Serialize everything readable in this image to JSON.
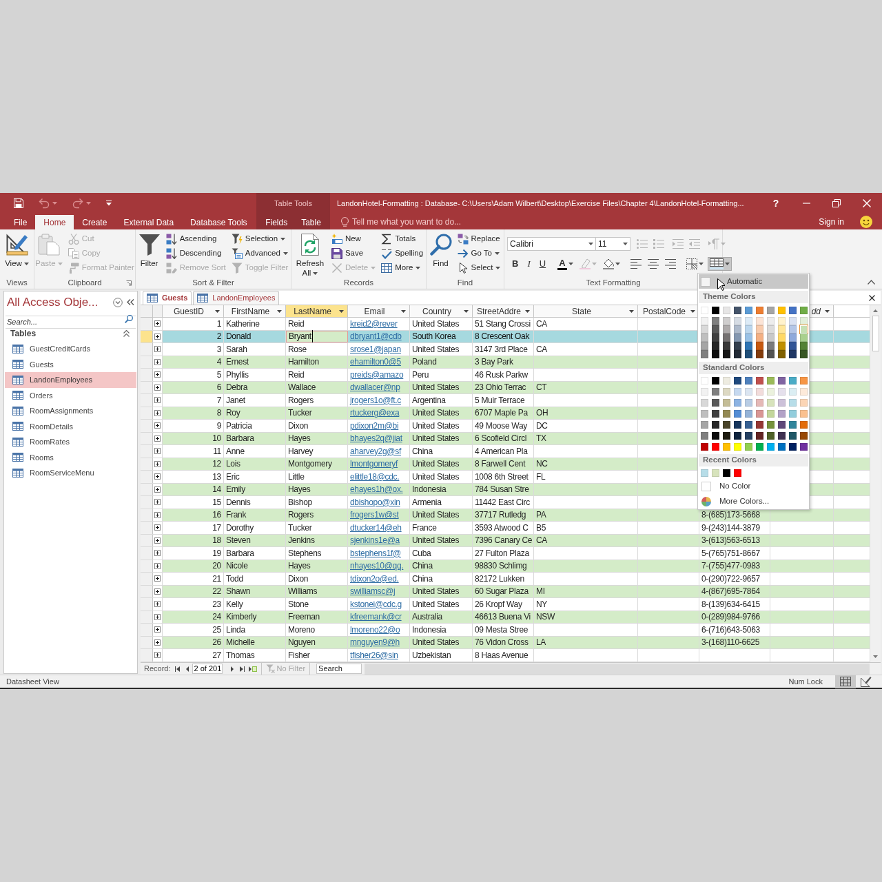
{
  "window": {
    "title": "LandonHotel-Formatting : Database- C:\\Users\\Adam Wilbert\\Desktop\\Exercise Files\\Chapter 4\\LandonHotel-Formatting...",
    "help": "?",
    "context_label": "Table Tools"
  },
  "quick_access": [
    {
      "kind": "save",
      "disabled": false
    },
    {
      "kind": "undo",
      "disabled": true,
      "dropdown": true
    },
    {
      "kind": "redo",
      "disabled": true,
      "dropdown": true
    },
    {
      "kind": "customize",
      "disabled": false
    }
  ],
  "ribbon_tabs": [
    {
      "label": "File",
      "selected": false,
      "contextual": false
    },
    {
      "label": "Home",
      "selected": true,
      "contextual": false
    },
    {
      "label": "Create",
      "selected": false,
      "contextual": false
    },
    {
      "label": "External Data",
      "selected": false,
      "contextual": false
    },
    {
      "label": "Database Tools",
      "selected": false,
      "contextual": false
    },
    {
      "label": "Fields",
      "selected": false,
      "contextual": true
    },
    {
      "label": "Table",
      "selected": false,
      "contextual": true
    }
  ],
  "tell_me": {
    "placeholder": "Tell me what you want to do..."
  },
  "account": {
    "label": "Sign in"
  },
  "ribbon_groups": [
    {
      "label": "Views",
      "kind": "commands",
      "launcher": false,
      "columns": [
        [
          {
            "large": true,
            "kind": "view",
            "label": "View",
            "dropdown": true,
            "disabled": false
          }
        ]
      ]
    },
    {
      "label": "Clipboard",
      "kind": "commands",
      "launcher": true,
      "columns": [
        [
          {
            "large": true,
            "kind": "paste",
            "label": "Paste",
            "dropdown": true,
            "disabled": true
          }
        ],
        [
          {
            "kind": "cut",
            "label": "Cut",
            "disabled": true
          },
          {
            "kind": "copy",
            "label": "Copy",
            "disabled": true
          },
          {
            "kind": "format-painter",
            "label": "Format Painter",
            "disabled": true
          }
        ]
      ]
    },
    {
      "label": "Sort & Filter",
      "kind": "commands",
      "launcher": false,
      "columns": [
        [
          {
            "large": true,
            "kind": "filter",
            "label": "Filter",
            "disabled": false
          }
        ],
        [
          {
            "kind": "ascending",
            "label": "Ascending",
            "disabled": false
          },
          {
            "kind": "descending",
            "label": "Descending",
            "disabled": false
          },
          {
            "kind": "remove-sort",
            "label": "Remove Sort",
            "disabled": true
          }
        ],
        [
          {
            "kind": "selection",
            "label": "Selection",
            "dropdown": true,
            "disabled": false
          },
          {
            "kind": "advanced",
            "label": "Advanced",
            "dropdown": true,
            "disabled": false
          },
          {
            "kind": "toggle-filter",
            "label": "Toggle Filter",
            "disabled": true
          }
        ]
      ]
    },
    {
      "label": "Records",
      "kind": "commands",
      "launcher": false,
      "columns": [
        [
          {
            "large": true,
            "kind": "refresh",
            "label": "Refresh All",
            "dropdown": true,
            "disabled": false
          }
        ],
        [
          {
            "kind": "new",
            "label": "New",
            "disabled": false
          },
          {
            "kind": "save",
            "label": "Save",
            "disabled": false
          },
          {
            "kind": "delete",
            "label": "Delete",
            "dropdown": true,
            "disabled": true
          }
        ],
        [
          {
            "kind": "totals",
            "label": "Totals",
            "disabled": false
          },
          {
            "kind": "spelling",
            "label": "Spelling",
            "disabled": false
          },
          {
            "kind": "more",
            "label": "More",
            "dropdown": true,
            "disabled": false
          }
        ]
      ]
    },
    {
      "label": "Find",
      "kind": "commands",
      "launcher": false,
      "columns": [
        [
          {
            "large": true,
            "kind": "find",
            "label": "Find",
            "disabled": false
          }
        ],
        [
          {
            "kind": "replace",
            "label": "Replace",
            "disabled": false
          },
          {
            "kind": "goto",
            "label": "Go To",
            "dropdown": true,
            "disabled": false
          },
          {
            "kind": "select",
            "label": "Select",
            "dropdown": true,
            "disabled": false
          }
        ]
      ]
    },
    {
      "label": "Text Formatting",
      "kind": "formatting",
      "launcher": false,
      "font": {
        "value": "Calibri"
      },
      "size": {
        "value": "11"
      },
      "top": [
        [
          {
            "kind": "bullets",
            "disabled": true
          },
          {
            "kind": "numbering",
            "disabled": true
          }
        ],
        [
          {
            "kind": "indent",
            "disabled": true
          },
          {
            "kind": "outdent",
            "disabled": true
          }
        ],
        [
          {
            "kind": "paragraph",
            "disabled": true,
            "dropdown": true,
            "expanded": false
          }
        ]
      ],
      "bottom": [
        [
          {
            "kind": "bold",
            "label": "B",
            "disabled": false
          },
          {
            "kind": "italic",
            "label": "I",
            "disabled": false
          },
          {
            "kind": "underline",
            "label": "U",
            "disabled": false
          }
        ],
        [
          {
            "kind": "font-color",
            "label": "A",
            "disabled": false,
            "dropdown": true,
            "expanded": false
          },
          {
            "kind": "highlight",
            "disabled": true,
            "dropdown": true,
            "expanded": false
          },
          {
            "kind": "fill",
            "disabled": false,
            "dropdown": true,
            "expanded": false
          }
        ],
        [
          {
            "kind": "align-left",
            "disabled": false
          },
          {
            "kind": "align-center",
            "disabled": false
          },
          {
            "kind": "align-right",
            "disabled": false
          }
        ],
        [
          {
            "kind": "gridlines",
            "disabled": false,
            "dropdown": true,
            "expanded": false
          },
          {
            "kind": "alternate-row",
            "disabled": false,
            "dropdown": true,
            "expanded": true
          }
        ]
      ]
    }
  ],
  "navigation": {
    "title": "All Access Obje...",
    "search": {
      "placeholder": "Search..."
    },
    "section": {
      "label": "Tables",
      "expanded": true
    },
    "items": [
      {
        "label": "GuestCreditCards",
        "selected": false
      },
      {
        "label": "Guests",
        "selected": false
      },
      {
        "label": "LandonEmployees",
        "selected": true
      },
      {
        "label": "Orders",
        "selected": false
      },
      {
        "label": "RoomAssignments",
        "selected": false
      },
      {
        "label": "RoomDetails",
        "selected": false
      },
      {
        "label": "RoomRates",
        "selected": false
      },
      {
        "label": "Rooms",
        "selected": false
      },
      {
        "label": "RoomServiceMenu",
        "selected": false
      }
    ]
  },
  "object_tabs": [
    {
      "label": "Guests",
      "selected": true
    },
    {
      "label": "LandonEmployees",
      "selected": false
    }
  ],
  "datasheet": {
    "columns": [
      {
        "label": "GuestID",
        "kind": "number",
        "selected": false
      },
      {
        "label": "FirstName",
        "kind": "text",
        "selected": false
      },
      {
        "label": "LastName",
        "kind": "text",
        "selected": true
      },
      {
        "label": "Email",
        "kind": "link",
        "selected": false
      },
      {
        "label": "Country",
        "kind": "text",
        "selected": false
      },
      {
        "label": "StreetAddre",
        "kind": "text",
        "selected": false
      },
      {
        "label": "State",
        "kind": "text",
        "selected": false
      },
      {
        "label": "PostalCode",
        "kind": "text",
        "selected": false
      },
      {
        "kind": "text"
      },
      {
        "label": "dd",
        "kind": "add",
        "selected": false
      }
    ],
    "rows": [
      {
        "selected": false,
        "guest_id": "1",
        "first_name": "Katherine",
        "last_name": "Reid",
        "email": "kreid2@rever",
        "country": "United States",
        "street_address": "51 Stang Crossi",
        "state": "CA"
      },
      {
        "selected": true,
        "guest_id": "2",
        "first_name": "Donald",
        "last_name": "Bryant",
        "email": "dbryant1@cdb",
        "country": "South Korea",
        "street_address": "8 Crescent Oak"
      },
      {
        "selected": false,
        "guest_id": "3",
        "first_name": "Sarah",
        "last_name": "Rose",
        "email": "srose1@japan",
        "country": "United States",
        "street_address": "3147 3rd Place",
        "state": "CA"
      },
      {
        "selected": false,
        "guest_id": "4",
        "first_name": "Ernest",
        "last_name": "Hamilton",
        "email": "ehamilton0@5",
        "country": "Poland",
        "street_address": "3 Bay Park"
      },
      {
        "selected": false,
        "guest_id": "5",
        "first_name": "Phyllis",
        "last_name": "Reid",
        "email": "preids@amazo",
        "country": "Peru",
        "street_address": "46 Rusk Parkw"
      },
      {
        "selected": false,
        "guest_id": "6",
        "first_name": "Debra",
        "last_name": "Wallace",
        "email": "dwallacer@np",
        "country": "United States",
        "street_address": "23 Ohio Terrac",
        "state": "CT"
      },
      {
        "selected": false,
        "guest_id": "7",
        "first_name": "Janet",
        "last_name": "Rogers",
        "email": "jrogers1o@ft.c",
        "country": "Argentina",
        "street_address": "5 Muir Terrace"
      },
      {
        "selected": false,
        "guest_id": "8",
        "first_name": "Roy",
        "last_name": "Tucker",
        "email": "rtuckerg@exa",
        "country": "United States",
        "street_address": "6707 Maple Pa",
        "state": "OH"
      },
      {
        "selected": false,
        "guest_id": "9",
        "first_name": "Patricia",
        "last_name": "Dixon",
        "email": "pdixon2m@bi",
        "country": "United States",
        "street_address": "49 Moose Way",
        "state": "DC"
      },
      {
        "selected": false,
        "guest_id": "10",
        "first_name": "Barbara",
        "last_name": "Hayes",
        "email": "bhayes2q@jiat",
        "country": "United States",
        "street_address": "6 Scofield Circl",
        "state": "TX"
      },
      {
        "selected": false,
        "guest_id": "11",
        "first_name": "Anne",
        "last_name": "Harvey",
        "email": "aharvey2g@sf",
        "country": "China",
        "street_address": "4 American Pla"
      },
      {
        "selected": false,
        "guest_id": "12",
        "first_name": "Lois",
        "last_name": "Montgomery",
        "email": "lmontgomeryf",
        "country": "United States",
        "street_address": "8 Farwell Cent",
        "state": "NC"
      },
      {
        "selected": false,
        "guest_id": "13",
        "first_name": "Eric",
        "last_name": "Little",
        "email": "elittle18@cdc.",
        "country": "United States",
        "street_address": "1008 6th Street",
        "state": "FL"
      },
      {
        "selected": false,
        "guest_id": "14",
        "first_name": "Emily",
        "last_name": "Hayes",
        "email": "ehayes1h@ox.",
        "country": "Indonesia",
        "street_address": "784 Susan Stre"
      },
      {
        "selected": false,
        "guest_id": "15",
        "first_name": "Dennis",
        "last_name": "Bishop",
        "email": "dbishopo@xin",
        "country": "Armenia",
        "street_address": "11442 East Circ"
      },
      {
        "selected": false,
        "guest_id": "16",
        "first_name": "Frank",
        "last_name": "Rogers",
        "email": "frogers1w@st",
        "country": "United States",
        "street_address": "37717 Rutledg",
        "state": "PA",
        "column_9": "8-(685)173-5668"
      },
      {
        "selected": false,
        "guest_id": "17",
        "first_name": "Dorothy",
        "last_name": "Tucker",
        "email": "dtucker14@eh",
        "country": "France",
        "street_address": "3593 Atwood C",
        "state": "B5",
        "column_9": "9-(243)144-3879"
      },
      {
        "selected": false,
        "guest_id": "18",
        "first_name": "Steven",
        "last_name": "Jenkins",
        "email": "sjenkins1e@a",
        "country": "United States",
        "street_address": "7396 Canary Ce",
        "state": "CA",
        "column_9": "3-(613)563-6513"
      },
      {
        "selected": false,
        "guest_id": "19",
        "first_name": "Barbara",
        "last_name": "Stephens",
        "email": "bstephens1f@",
        "country": "Cuba",
        "street_address": "27 Fulton Plaza",
        "column_9": "5-(765)751-8667"
      },
      {
        "selected": false,
        "guest_id": "20",
        "first_name": "Nicole",
        "last_name": "Hayes",
        "email": "nhayes10@qq.",
        "country": "China",
        "street_address": "98830 Schlimg",
        "column_9": "7-(755)477-0983"
      },
      {
        "selected": false,
        "guest_id": "21",
        "first_name": "Todd",
        "last_name": "Dixon",
        "email": "tdixon2o@ed.",
        "country": "China",
        "street_address": "82172 Lukken",
        "column_9": "0-(290)722-9657"
      },
      {
        "selected": false,
        "guest_id": "22",
        "first_name": "Shawn",
        "last_name": "Williams",
        "email": "swilliamsc@j",
        "country": "United States",
        "street_address": "60 Sugar Plaza",
        "state": "MI",
        "column_9": "4-(867)695-7864"
      },
      {
        "selected": false,
        "guest_id": "23",
        "first_name": "Kelly",
        "last_name": "Stone",
        "email": "kstonei@cdc.g",
        "country": "United States",
        "street_address": "26 Kropf Way",
        "state": "NY",
        "column_9": "8-(139)634-6415"
      },
      {
        "selected": false,
        "guest_id": "24",
        "first_name": "Kimberly",
        "last_name": "Freeman",
        "email": "kfreemank@cr",
        "country": "Australia",
        "street_address": "46613 Buena Vi",
        "state": "NSW",
        "column_9": "0-(289)984-9766"
      },
      {
        "selected": false,
        "guest_id": "25",
        "first_name": "Linda",
        "last_name": "Moreno",
        "email": "lmoreno22@o",
        "country": "Indonesia",
        "street_address": "09 Mesta Stree",
        "column_9": "6-(716)643-5063"
      },
      {
        "selected": false,
        "guest_id": "26",
        "first_name": "Michelle",
        "last_name": "Nguyen",
        "email": "mnguyen9@h",
        "country": "United States",
        "street_address": "76 Vidon Cross",
        "state": "LA",
        "column_9": "3-(168)110-6625"
      },
      {
        "selected": false,
        "guest_id": "27",
        "first_name": "Thomas",
        "last_name": "Fisher",
        "email": "tfisher26@sin",
        "country": "Uzbekistan",
        "street_address": "8 Haas Avenue"
      }
    ]
  },
  "record_navigator": {
    "label": "Record:",
    "position": "2 of 201",
    "filter": {
      "label": "No Filter",
      "disabled": true
    },
    "search": {
      "placeholder": "Search"
    }
  },
  "color_menu": {
    "automatic": {
      "label": "Automatic",
      "selected": true
    },
    "theme": {
      "title": "Theme Colors",
      "swatches": [
        {
          "color": "#ffffff",
          "selected": false
        },
        {
          "color": "#000000",
          "selected": false
        },
        {
          "color": "#e7e6e6",
          "selected": false
        },
        {
          "color": "#44546a",
          "selected": false
        },
        {
          "color": "#5b9bd5",
          "selected": false
        },
        {
          "color": "#ed7d31",
          "selected": false
        },
        {
          "color": "#a5a5a5",
          "selected": false
        },
        {
          "color": "#ffc000",
          "selected": false
        },
        {
          "color": "#4472c4",
          "selected": false
        },
        {
          "color": "#70ad47",
          "selected": false
        },
        {
          "color": "#f2f2f2",
          "selected": false
        },
        {
          "color": "#7f7f7f",
          "selected": false
        },
        {
          "color": "#d0cece",
          "selected": false
        },
        {
          "color": "#d6dce4",
          "selected": false
        },
        {
          "color": "#ddebf7",
          "selected": false
        },
        {
          "color": "#fce4d6",
          "selected": false
        },
        {
          "color": "#ededed",
          "selected": false
        },
        {
          "color": "#fff2cc",
          "selected": false
        },
        {
          "color": "#d9e1f2",
          "selected": false
        },
        {
          "color": "#e2efda",
          "selected": false
        },
        {
          "color": "#d9d9d9",
          "selected": false
        },
        {
          "color": "#595959",
          "selected": false
        },
        {
          "color": "#aeaaaa",
          "selected": false
        },
        {
          "color": "#adb9ca",
          "selected": false
        },
        {
          "color": "#bdd7ee",
          "selected": false
        },
        {
          "color": "#f8cbad",
          "selected": false
        },
        {
          "color": "#dbdbdb",
          "selected": false
        },
        {
          "color": "#ffe699",
          "selected": false
        },
        {
          "color": "#b4c6e7",
          "selected": false
        },
        {
          "color": "#c6e0b4",
          "selected": true
        },
        {
          "color": "#bfbfbf",
          "selected": false
        },
        {
          "color": "#404040",
          "selected": false
        },
        {
          "color": "#757171",
          "selected": false
        },
        {
          "color": "#8497b0",
          "selected": false
        },
        {
          "color": "#9bc2e6",
          "selected": false
        },
        {
          "color": "#f4b084",
          "selected": false
        },
        {
          "color": "#c9c9c9",
          "selected": false
        },
        {
          "color": "#ffd966",
          "selected": false
        },
        {
          "color": "#8ea9db",
          "selected": false
        },
        {
          "color": "#a9d08e",
          "selected": false
        },
        {
          "color": "#a6a6a6",
          "selected": false
        },
        {
          "color": "#262626",
          "selected": false
        },
        {
          "color": "#3a3838",
          "selected": false
        },
        {
          "color": "#333f4f",
          "selected": false
        },
        {
          "color": "#2f75b5",
          "selected": false
        },
        {
          "color": "#c65911",
          "selected": false
        },
        {
          "color": "#7b7b7b",
          "selected": false
        },
        {
          "color": "#bf8f00",
          "selected": false
        },
        {
          "color": "#305496",
          "selected": false
        },
        {
          "color": "#548235",
          "selected": false
        },
        {
          "color": "#808080",
          "selected": false
        },
        {
          "color": "#0d0d0d",
          "selected": false
        },
        {
          "color": "#171616",
          "selected": false
        },
        {
          "color": "#222a35",
          "selected": false
        },
        {
          "color": "#1f4e78",
          "selected": false
        },
        {
          "color": "#833c0c",
          "selected": false
        },
        {
          "color": "#525252",
          "selected": false
        },
        {
          "color": "#806000",
          "selected": false
        },
        {
          "color": "#203764",
          "selected": false
        },
        {
          "color": "#375623",
          "selected": false
        }
      ]
    },
    "standard": {
      "title": "Standard Colors",
      "swatches": [
        {
          "color": "#ffffff",
          "selected": false
        },
        {
          "color": "#000000",
          "selected": false
        },
        {
          "color": "#eeece1",
          "selected": false
        },
        {
          "color": "#1f497d",
          "selected": false
        },
        {
          "color": "#4f81bd",
          "selected": false
        },
        {
          "color": "#c0504d",
          "selected": false
        },
        {
          "color": "#9bbb59",
          "selected": false
        },
        {
          "color": "#8064a2",
          "selected": false
        },
        {
          "color": "#4bacc6",
          "selected": false
        },
        {
          "color": "#f79646",
          "selected": false
        },
        {
          "color": "#f2f2f2",
          "selected": false
        },
        {
          "color": "#7f7f7f",
          "selected": false
        },
        {
          "color": "#ddd9c3",
          "selected": false
        },
        {
          "color": "#c6d9f0",
          "selected": false
        },
        {
          "color": "#dbe5f1",
          "selected": false
        },
        {
          "color": "#f2dcdb",
          "selected": false
        },
        {
          "color": "#ebf1dd",
          "selected": false
        },
        {
          "color": "#e5e0ec",
          "selected": false
        },
        {
          "color": "#dbeef3",
          "selected": false
        },
        {
          "color": "#fdeada",
          "selected": false
        },
        {
          "color": "#d8d8d8",
          "selected": false
        },
        {
          "color": "#595959",
          "selected": false
        },
        {
          "color": "#c4bd97",
          "selected": false
        },
        {
          "color": "#8db3e2",
          "selected": false
        },
        {
          "color": "#b8cce4",
          "selected": false
        },
        {
          "color": "#e5b9b7",
          "selected": false
        },
        {
          "color": "#d7e3bc",
          "selected": false
        },
        {
          "color": "#ccc1d9",
          "selected": false
        },
        {
          "color": "#b7dde8",
          "selected": false
        },
        {
          "color": "#fbd5b5",
          "selected": false
        },
        {
          "color": "#bfbfbf",
          "selected": false
        },
        {
          "color": "#3f3f3f",
          "selected": false
        },
        {
          "color": "#938953",
          "selected": false
        },
        {
          "color": "#548dd4",
          "selected": false
        },
        {
          "color": "#95b3d7",
          "selected": false
        },
        {
          "color": "#d99694",
          "selected": false
        },
        {
          "color": "#c3d69b",
          "selected": false
        },
        {
          "color": "#b2a2c7",
          "selected": false
        },
        {
          "color": "#92cddc",
          "selected": false
        },
        {
          "color": "#fac08f",
          "selected": false
        },
        {
          "color": "#a5a5a5",
          "selected": false
        },
        {
          "color": "#262626",
          "selected": false
        },
        {
          "color": "#494429",
          "selected": false
        },
        {
          "color": "#17365d",
          "selected": false
        },
        {
          "color": "#366092",
          "selected": false
        },
        {
          "color": "#953734",
          "selected": false
        },
        {
          "color": "#76923c",
          "selected": false
        },
        {
          "color": "#5f497a",
          "selected": false
        },
        {
          "color": "#31859b",
          "selected": false
        },
        {
          "color": "#e36c09",
          "selected": false
        },
        {
          "color": "#7f7f7f",
          "selected": false
        },
        {
          "color": "#0c0c0c",
          "selected": false
        },
        {
          "color": "#1d1b10",
          "selected": false
        },
        {
          "color": "#0f243e",
          "selected": false
        },
        {
          "color": "#244061",
          "selected": false
        },
        {
          "color": "#632423",
          "selected": false
        },
        {
          "color": "#4f6128",
          "selected": false
        },
        {
          "color": "#3f3151",
          "selected": false
        },
        {
          "color": "#205867",
          "selected": false
        },
        {
          "color": "#974806",
          "selected": false
        },
        {
          "color": "#c00000",
          "selected": false
        },
        {
          "color": "#ff0000",
          "selected": false
        },
        {
          "color": "#ffc000",
          "selected": false
        },
        {
          "color": "#ffff00",
          "selected": false
        },
        {
          "color": "#92d050",
          "selected": false
        },
        {
          "color": "#00b050",
          "selected": false
        },
        {
          "color": "#00b0f0",
          "selected": false
        },
        {
          "color": "#0070c0",
          "selected": false
        },
        {
          "color": "#002060",
          "selected": false
        },
        {
          "color": "#7030a0",
          "selected": false
        }
      ]
    },
    "recent": {
      "title": "Recent Colors",
      "swatches": [
        {
          "color": "#b7dde8",
          "selected": false
        },
        {
          "color": "#d7e3bc",
          "selected": false
        },
        {
          "color": "#000000",
          "selected": false
        },
        {
          "color": "#ff0000",
          "selected": false
        }
      ]
    },
    "no_color": {
      "label": "No Color"
    },
    "more_colors": {
      "label": "More Colors..."
    }
  },
  "status_bar": {
    "text": "Datasheet View",
    "indicator": "Num Lock",
    "views": [
      {
        "kind": "datasheet",
        "selected": true
      },
      {
        "kind": "design",
        "selected": false
      }
    ]
  }
}
